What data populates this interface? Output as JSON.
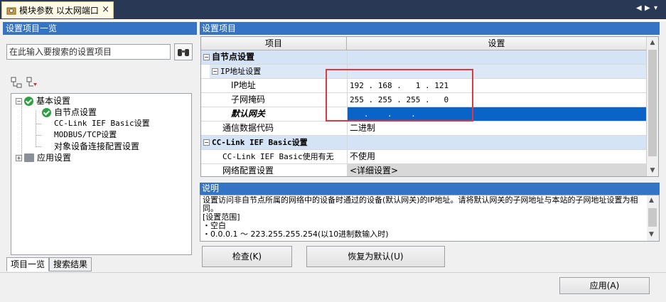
{
  "tab": {
    "title": "模块参数 以太网端口",
    "close": "×"
  },
  "window_controls": {
    "left": "◀",
    "right": "▶",
    "menu": "▾"
  },
  "left_panel": {
    "header": "设置项目一览",
    "search_placeholder": "在此输入要搜索的设置项目",
    "tree": {
      "basic": "基本设置",
      "own_node": "自节点设置",
      "cc_link": "CC-Link IEF Basic设置",
      "modbus": "MODBUS/TCP设置",
      "target": "对象设备连接配置设置",
      "app": "应用设置"
    },
    "bottom_tabs": [
      "项目一览",
      "搜索结果"
    ]
  },
  "right_panel": {
    "header": "设置项目",
    "columns": {
      "item": "项目",
      "setting": "设置"
    },
    "rows": {
      "own_node": "自节点设置",
      "ip_settings": "IP地址设置",
      "ip_address": "IP地址",
      "ip_value": "192 . 168 .   1 . 121",
      "subnet": "子网掩码",
      "subnet_value": "255 . 255 . 255 .   0",
      "gateway": "默认网关",
      "gateway_value": "   .    .    .",
      "comm_code": "通信数据代码",
      "comm_value": "二进制",
      "cc_link_settings": "CC-Link IEF Basic设置",
      "cc_link_use": "CC-Link IEF Basic使用有无",
      "cc_link_use_value": "不使用",
      "network_config": "网络配置设置",
      "network_config_value": "<详细设置>"
    }
  },
  "description": {
    "header": "说明",
    "line1": "设置访问非自节点所属的网络中的设备时通过的设备(默认网关)的IP地址。请将默认网关的子网地址与本站的子网地址设置为相同。",
    "line2": "[设置范围]",
    "line3": "・空白",
    "line4": "・0.0.0.1 ～ 223.255.255.254(以10进制数输入时)"
  },
  "buttons": {
    "check": "检查(K)",
    "restore": "恢复为默认(U)",
    "apply": "应用(A)"
  },
  "colors": {
    "header_blue": "#3574c4",
    "selected": "#0a64c8",
    "highlight_red": "#e0383e"
  }
}
